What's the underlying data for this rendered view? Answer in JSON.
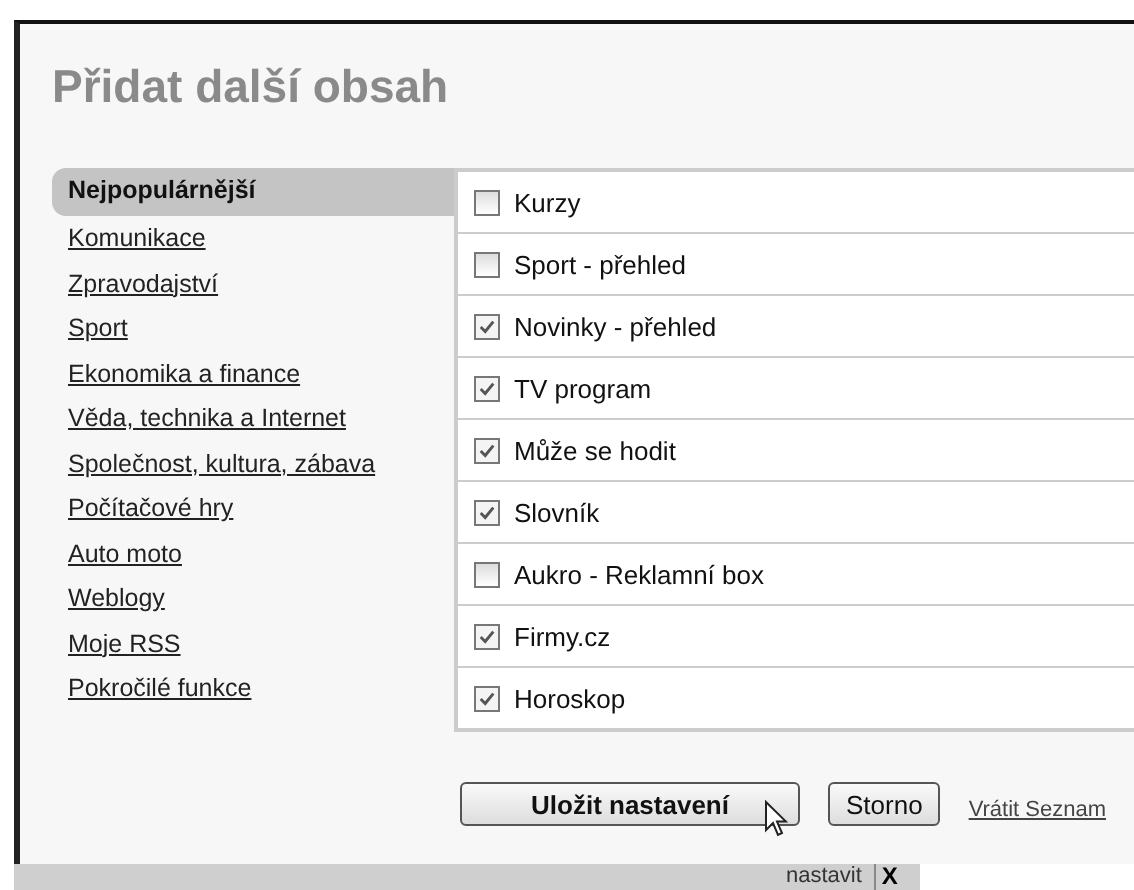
{
  "title": "Přidat další obsah",
  "categories": [
    {
      "label": "Nejpopulárnější",
      "selected": true
    },
    {
      "label": "Komunikace",
      "selected": false
    },
    {
      "label": "Zpravodajství",
      "selected": false
    },
    {
      "label": "Sport",
      "selected": false
    },
    {
      "label": "Ekonomika a finance",
      "selected": false
    },
    {
      "label": "Věda, technika a Internet",
      "selected": false
    },
    {
      "label": "Společnost, kultura, zábava",
      "selected": false
    },
    {
      "label": "Počítačové hry",
      "selected": false
    },
    {
      "label": "Auto moto",
      "selected": false
    },
    {
      "label": "Weblogy",
      "selected": false
    },
    {
      "label": "Moje RSS",
      "selected": false
    },
    {
      "label": "Pokročilé funkce",
      "selected": false
    }
  ],
  "items": [
    {
      "label": "Kurzy",
      "checked": false
    },
    {
      "label": "Sport - přehled",
      "checked": false
    },
    {
      "label": "Novinky - přehled",
      "checked": true
    },
    {
      "label": "TV program",
      "checked": true
    },
    {
      "label": "Může se hodit",
      "checked": true
    },
    {
      "label": "Slovník",
      "checked": true
    },
    {
      "label": "Aukro - Reklamní box",
      "checked": false
    },
    {
      "label": "Firmy.cz",
      "checked": true
    },
    {
      "label": "Horoskop",
      "checked": true
    }
  ],
  "buttons": {
    "save": "Uložit nastavení",
    "cancel": "Storno",
    "restore_link": "Vrátit Seznam"
  },
  "bottom_bar": {
    "label": "nastavit",
    "close": "X"
  }
}
